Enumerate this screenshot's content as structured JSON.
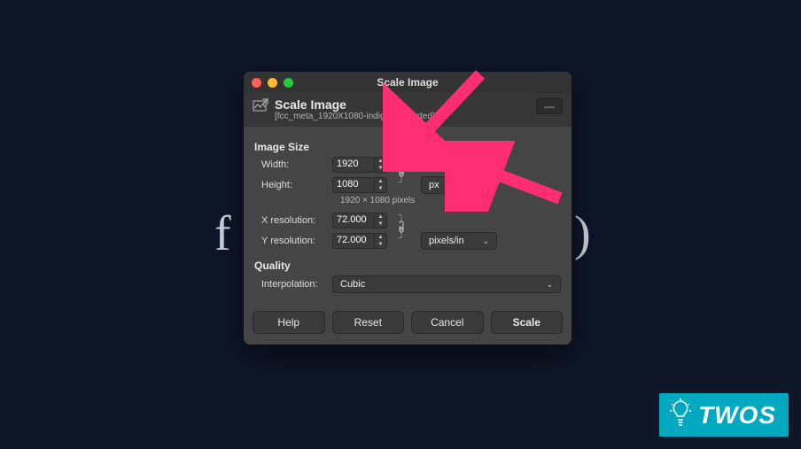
{
  "titlebar": {
    "title": "Scale Image"
  },
  "header": {
    "heading": "Scale Image",
    "subheading": "[fcc_meta_1920X1080-indigo] (imported)"
  },
  "imageSize": {
    "section_label": "Image Size",
    "width_label": "Width:",
    "height_label": "Height:",
    "width_value": "1920",
    "height_value": "1080",
    "dims_hint": "1920 × 1080 pixels",
    "unit_selected": "px"
  },
  "resolution": {
    "x_label": "X resolution:",
    "y_label": "Y resolution:",
    "x_value": "72.000",
    "y_value": "72.000",
    "unit_selected": "pixels/in"
  },
  "quality": {
    "section_label": "Quality",
    "interpolation_label": "Interpolation:",
    "interpolation_value": "Cubic"
  },
  "footer": {
    "help": "Help",
    "reset": "Reset",
    "cancel": "Cancel",
    "scale": "Scale"
  },
  "branding": {
    "name": "TWOS"
  }
}
